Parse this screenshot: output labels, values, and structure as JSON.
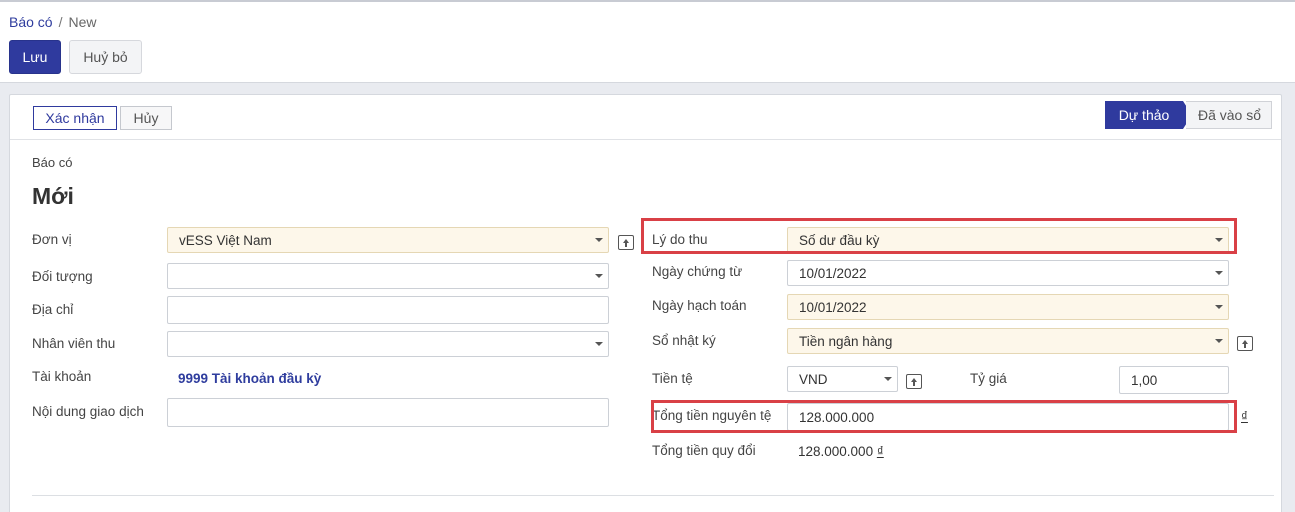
{
  "breadcrumb": {
    "parent": "Báo có",
    "separator": "/",
    "current": "New"
  },
  "toolbar": {
    "save_label": "Lưu",
    "discard_label": "Huỷ bỏ"
  },
  "statusbar": {
    "confirm_label": "Xác nhận",
    "cancel_label": "Hủy",
    "stages": {
      "active": "Dự thảo",
      "next": "Đã vào sổ"
    }
  },
  "doc": {
    "type": "Báo có",
    "name": "Mới"
  },
  "left": {
    "don_vi": {
      "label": "Đơn vị",
      "value": "vESS Việt Nam"
    },
    "doi_tuong": {
      "label": "Đối tượng",
      "value": ""
    },
    "dia_chi": {
      "label": "Địa chỉ",
      "value": ""
    },
    "nhan_vien_thu": {
      "label": "Nhân viên thu",
      "value": ""
    },
    "tai_khoan": {
      "label": "Tài khoản",
      "value": "9999 Tài khoản đầu kỳ"
    },
    "noi_dung": {
      "label": "Nội dung giao dịch",
      "value": ""
    }
  },
  "right": {
    "ly_do_thu": {
      "label": "Lý do thu",
      "value": "Số dư đầu kỳ"
    },
    "ngay_chung_tu": {
      "label": "Ngày chứng từ",
      "value": "10/01/2022"
    },
    "ngay_hach_toan": {
      "label": "Ngày hạch toán",
      "value": "10/01/2022"
    },
    "so_nhat_ky": {
      "label": "Sổ nhật ký",
      "value": "Tiền ngân hàng"
    },
    "tien_te": {
      "label": "Tiền tệ",
      "value": "VND"
    },
    "ty_gia": {
      "label": "Tỷ giá",
      "value": "1,00"
    },
    "tong_tien_nguyen_te": {
      "label": "Tổng tiền nguyên tệ",
      "value": "128.000.000",
      "currency_symbol": "₫"
    },
    "tong_tien_quy_doi": {
      "label": "Tổng tiền quy đổi",
      "value": "128.000.000",
      "currency_symbol": "₫"
    }
  },
  "colors": {
    "primary": "#2f3a9e",
    "required_bg": "#fdf7ea",
    "highlight": "#d94046"
  }
}
